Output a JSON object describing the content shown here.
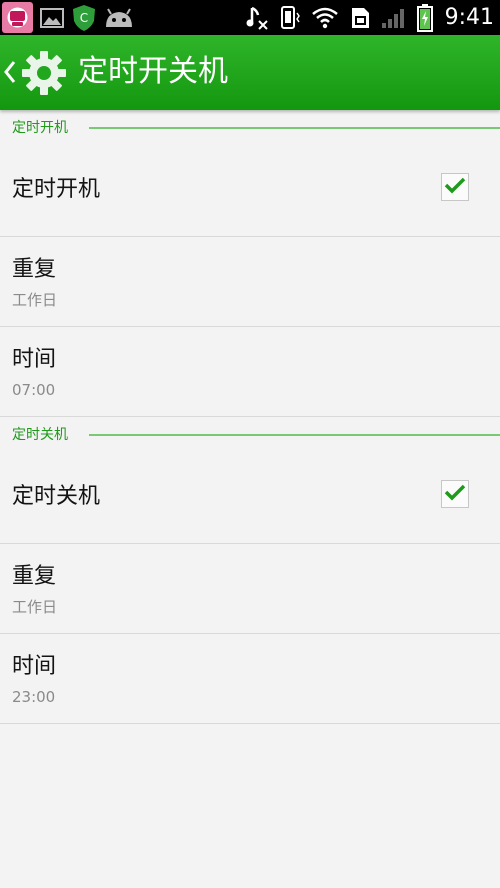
{
  "status_bar": {
    "time": "9:41",
    "left_icons": [
      "app-notification-icon",
      "gallery-icon",
      "shield-app-icon",
      "android-icon"
    ],
    "right_icons": [
      "music-muted-icon",
      "vibrate-icon",
      "wifi-icon",
      "sim-icon",
      "signal-icon",
      "battery-charging-icon"
    ]
  },
  "action_bar": {
    "title": "定时开关机",
    "back_icon": "chevron-left-icon",
    "app_icon": "gear-icon",
    "color": "#1fa81b"
  },
  "sections": [
    {
      "header": "定时开机",
      "toggle": {
        "label": "定时开机",
        "checked": true
      },
      "repeat": {
        "label": "重复",
        "value": "工作日"
      },
      "time": {
        "label": "时间",
        "value": "07:00"
      }
    },
    {
      "header": "定时关机",
      "toggle": {
        "label": "定时关机",
        "checked": true
      },
      "repeat": {
        "label": "重复",
        "value": "工作日"
      },
      "time": {
        "label": "时间",
        "value": "23:00"
      }
    }
  ]
}
